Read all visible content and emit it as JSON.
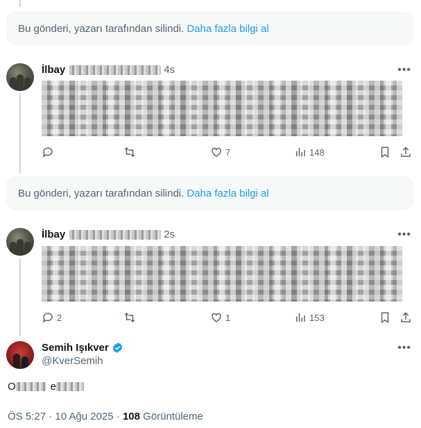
{
  "deleted_notice": {
    "text": "Bu gönderi, yazarı tarafından silindi.",
    "link": "Daha fazla bilgi al"
  },
  "replies": [
    {
      "name": "İlbay",
      "time": "4s",
      "counts": {
        "reply": "",
        "retweet": "",
        "like": "7",
        "views": "148"
      }
    },
    {
      "name": "İlbay",
      "time": "2s",
      "counts": {
        "reply": "2",
        "retweet": "",
        "like": "1",
        "views": "153"
      }
    }
  ],
  "main_tweet": {
    "name": "Semih Işıkver",
    "handle": "@KverSemih",
    "text_start": "O",
    "text_mid": "e",
    "timestamp": "ÖS 5:27 · 10 Ağu 2025 · ",
    "views": "108",
    "views_label": " Görüntüleme"
  },
  "colors": {
    "accent": "#1d9bf0",
    "muted": "#536471",
    "verified": "#1d9bf0"
  }
}
